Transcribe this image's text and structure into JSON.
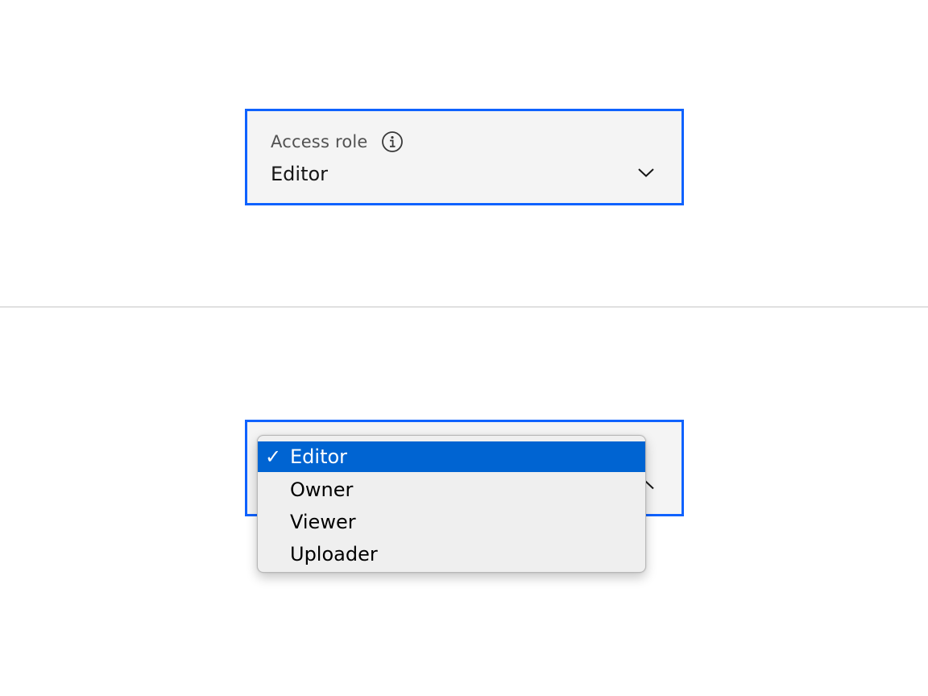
{
  "closed_select": {
    "label": "Access role",
    "info_icon": "info-icon",
    "value": "Editor",
    "chevron_icon": "chevron-down-icon"
  },
  "open_select": {
    "chevron_icon": "chevron-up-icon",
    "check_icon": "checkmark-icon",
    "check_glyph": "✓",
    "options": [
      {
        "label": "Editor",
        "selected": true
      },
      {
        "label": "Owner",
        "selected": false
      },
      {
        "label": "Viewer",
        "selected": false
      },
      {
        "label": "Uploader",
        "selected": false
      }
    ]
  },
  "colors": {
    "focus_border": "#0f62fe",
    "field_background": "#f4f4f4",
    "highlight": "#0064d2"
  }
}
